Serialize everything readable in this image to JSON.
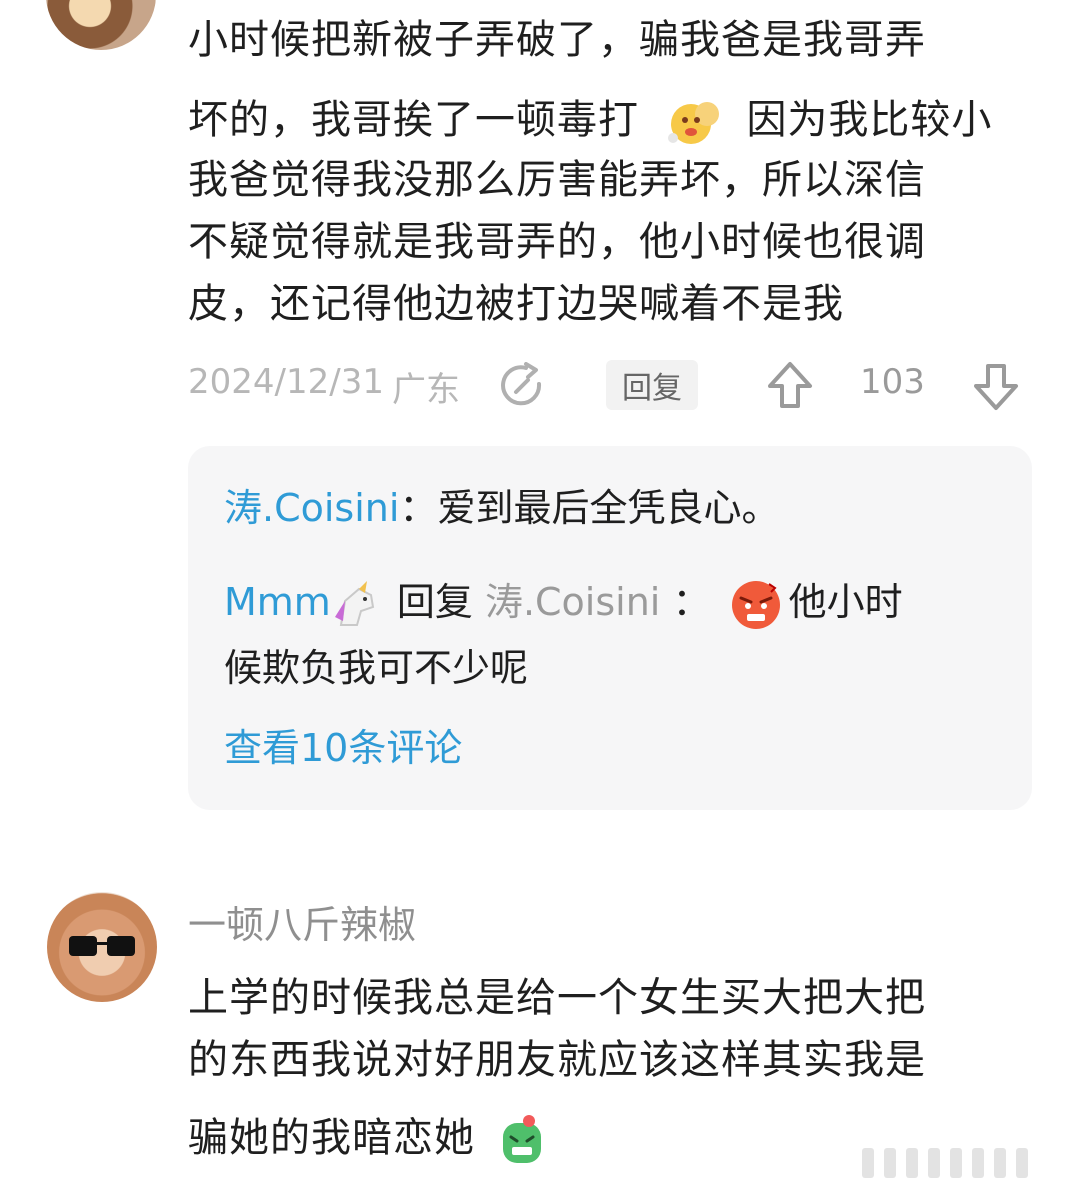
{
  "comment1": {
    "lines": [
      "小时候把新被子弄破了，骗我爸是我哥弄",
      "坏的，我哥挨了一顿毒打",
      "因为我比较小",
      "我爸觉得我没那么厉害能弄坏，所以深信",
      "不疑觉得就是我哥弄的，他小时候也很调",
      "皮，还记得他边被打边哭喊着不是我"
    ],
    "date": "2024/12/31",
    "location": "广东",
    "reply_label": "回复",
    "like_count": "103",
    "icons": [
      "share-icon",
      "thumb-up-icon",
      "thumb-down-icon"
    ],
    "replies": [
      {
        "user": "涛.Coisini",
        "separator": "：",
        "text": "爱到最后全凭良心。"
      },
      {
        "user": "Mmm",
        "action": "回复",
        "target": "涛.Coisini",
        "separator": "：",
        "text_line1": "他小时",
        "text_line2": "候欺负我可不少呢"
      }
    ],
    "view_more": "查看10条评论"
  },
  "comment2": {
    "username": "一顿八斤辣椒",
    "lines": [
      "上学的时候我总是给一个女生买大把大把",
      "的东西我说对好朋友就应该这样其实我是",
      "骗她的我暗恋她"
    ]
  },
  "colors": {
    "accent": "#2f9bd6",
    "meta": "#b7b7b7"
  }
}
